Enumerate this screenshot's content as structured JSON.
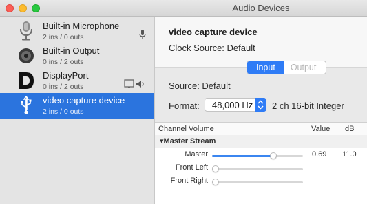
{
  "window": {
    "title": "Audio Devices"
  },
  "devices": [
    {
      "name": "Built-in Microphone",
      "io": "2 ins / 0 outs",
      "icon": "microphone-icon",
      "badge": "microphone-badge-icon"
    },
    {
      "name": "Built-in Output",
      "io": "0 ins / 2 outs",
      "icon": "speaker-icon"
    },
    {
      "name": "DisplayPort",
      "io": "0 ins / 2 outs",
      "icon": "displayport-icon",
      "badge": "display-speaker-badge-icon"
    },
    {
      "name": "video capture device",
      "io": "2 ins / 0 outs",
      "icon": "usb-icon",
      "selected": true
    }
  ],
  "detail": {
    "device_name": "video capture device",
    "clock_source": "Clock Source:  Default",
    "tabs": [
      "Input",
      "Output"
    ],
    "active_tab": "Input",
    "source": "Source:  Default",
    "format_label": "Format:",
    "format_rate": "48,000 Hz",
    "format_desc": "2 ch 16-bit Integer"
  },
  "table": {
    "headers": [
      "Channel Volume",
      "Value",
      "dB"
    ],
    "group": "Master Stream",
    "rows": [
      {
        "label": "Master",
        "level": 0.69,
        "value": "0.69",
        "db": "11.0"
      },
      {
        "label": "Front Left",
        "level": 0.0,
        "value": "",
        "db": ""
      },
      {
        "label": "Front Right",
        "level": 0.0,
        "value": "",
        "db": ""
      }
    ]
  },
  "colors": {
    "selection": "#2b74de",
    "accent": "#2f7cf6"
  }
}
